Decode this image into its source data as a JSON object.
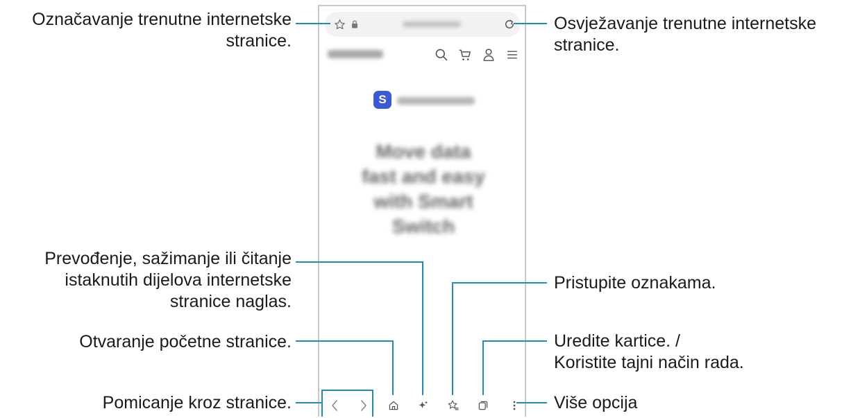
{
  "annotations": {
    "bookmark_current": "Označavanje trenutne internetske stranice.",
    "refresh_current": "Osvježavanje trenutne internetske stranice.",
    "translate_summarize": "Prevođenje, sažimanje ili čitanje istaknutih dijelova internetske stranice naglas.",
    "access_bookmarks": "Pristupite oznakama.",
    "open_home": "Otvaranje početne stranice.",
    "edit_tabs": "Uredite kartice. / Koristite tajni način rada.",
    "navigate_pages": "Pomicanje kroz stranice.",
    "more_options": "Više opcija"
  },
  "label_lines": {
    "bookmark_current": [
      "Označavanje trenutne internetske",
      "stranice."
    ],
    "refresh_current": [
      "Osvježavanje trenutne internetske",
      "stranice."
    ],
    "translate_summarize": [
      "Prevođenje, sažimanje ili čitanje",
      "istaknutih dijelova internetske",
      "stranice naglas."
    ],
    "access_bookmarks": [
      "Pristupite oznakama."
    ],
    "open_home": [
      "Otvaranje početne stranice."
    ],
    "edit_tabs": [
      "Uredite kartice. /",
      "Koristite tajni način rada."
    ],
    "navigate_pages": [
      "Pomicanje kroz stranice."
    ],
    "more_options": [
      "Više opcija"
    ]
  },
  "browser": {
    "app_badge_letter": "S",
    "hero_lines": [
      "Move data",
      "fast and easy",
      "with Smart Switch"
    ]
  },
  "colors": {
    "callout_line": "#1e8cb6",
    "app_badge": "#3a5bd4"
  },
  "icons": [
    "star-icon",
    "lock-icon",
    "refresh-icon",
    "search-icon",
    "cart-icon",
    "user-icon",
    "menu-icon",
    "back-icon",
    "forward-icon",
    "home-icon",
    "sparkle-icon",
    "bookmarks-icon",
    "tabs-icon",
    "more-icon"
  ]
}
